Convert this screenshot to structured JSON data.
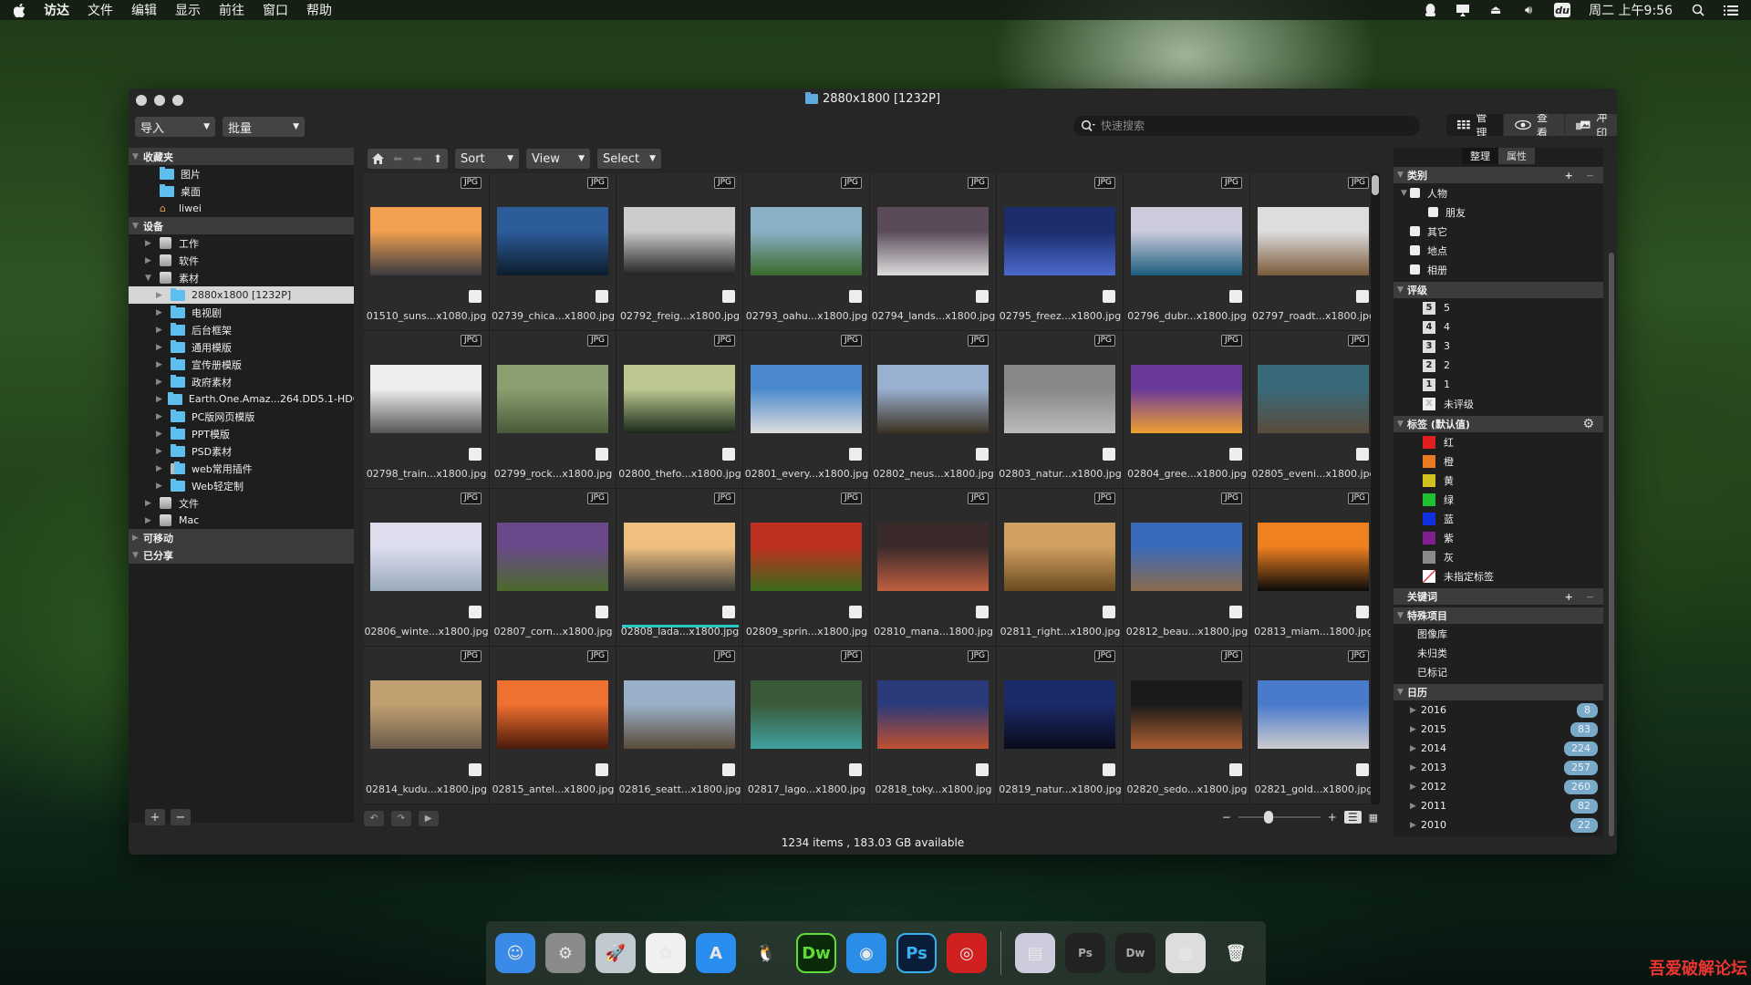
{
  "menubar": {
    "items": [
      "访达",
      "文件",
      "编辑",
      "显示",
      "前往",
      "窗口",
      "帮助"
    ],
    "clock": "周二 上午9:56",
    "icons": [
      "qq-icon",
      "airplay-icon",
      "eject-icon",
      "volume-icon",
      "du-icon",
      "search-icon",
      "list-icon"
    ]
  },
  "window": {
    "title": "2880x1800 [1232P]",
    "import_label": "导入",
    "batch_label": "批量",
    "search_placeholder": "快速搜索",
    "modes": [
      {
        "label": "管理",
        "icon": "grid-icon",
        "active": true
      },
      {
        "label": "查看",
        "icon": "eye-icon",
        "active": false
      },
      {
        "label": "冲印",
        "icon": "print-icon",
        "active": false
      }
    ],
    "extra_icons": [
      "365-icon",
      "sync-icon"
    ]
  },
  "sidebar": {
    "sections": [
      {
        "title": "收藏夹",
        "open": true,
        "items": [
          {
            "label": "图片",
            "icon": "folder",
            "level": 1
          },
          {
            "label": "桌面",
            "icon": "folder",
            "level": 1
          },
          {
            "label": "liwei",
            "icon": "home",
            "level": 1
          }
        ]
      },
      {
        "title": "设备",
        "open": true,
        "items": [
          {
            "label": "工作",
            "icon": "drive",
            "level": 1,
            "tri": "▶"
          },
          {
            "label": "软件",
            "icon": "drive",
            "level": 1,
            "tri": "▶"
          },
          {
            "label": "素材",
            "icon": "drive",
            "level": 1,
            "tri": "▼"
          },
          {
            "label": "2880x1800 [1232P]",
            "icon": "folder",
            "level": 2,
            "tri": "▶",
            "selected": true
          },
          {
            "label": "电视剧",
            "icon": "folder",
            "level": 2,
            "tri": "▶"
          },
          {
            "label": "后台框架",
            "icon": "folder",
            "level": 2,
            "tri": "▶"
          },
          {
            "label": "通用模版",
            "icon": "folder",
            "level": 2,
            "tri": "▶"
          },
          {
            "label": "宣传册模版",
            "icon": "folder",
            "level": 2,
            "tri": "▶"
          },
          {
            "label": "政府素材",
            "icon": "folder",
            "level": 2,
            "tri": "▶"
          },
          {
            "label": "Earth.One.Amaz...264.DD5.1-HDC",
            "icon": "folder",
            "level": 2,
            "tri": "▶"
          },
          {
            "label": "PC版网页模版",
            "icon": "folder",
            "level": 2,
            "tri": "▶"
          },
          {
            "label": "PPT模版",
            "icon": "folder",
            "level": 2,
            "tri": "▶"
          },
          {
            "label": "PSD素材",
            "icon": "folder",
            "level": 2,
            "tri": "▶"
          },
          {
            "label": "web常用插件",
            "icon": "folder-locked",
            "level": 2,
            "tri": "▶"
          },
          {
            "label": "Web轻定制",
            "icon": "folder",
            "level": 2,
            "tri": "▶"
          },
          {
            "label": "文件",
            "icon": "drive",
            "level": 1,
            "tri": "▶"
          },
          {
            "label": "Mac",
            "icon": "drive",
            "level": 1,
            "tri": "▶"
          }
        ]
      },
      {
        "title": "可移动",
        "open": false,
        "items": []
      },
      {
        "title": "已分享",
        "open": true,
        "items": []
      }
    ],
    "add_label": "+",
    "remove_label": "−"
  },
  "navbar": {
    "sort": "Sort",
    "view": "View",
    "select": "Select"
  },
  "files": [
    {
      "name": "01510_suns...x1080.jpg",
      "type": "JPG",
      "colors": [
        "#f0a050",
        "#3a3a40"
      ]
    },
    {
      "name": "02739_chica...x1800.jpg",
      "type": "JPG",
      "colors": [
        "#2c5c9a",
        "#0c1c2c"
      ]
    },
    {
      "name": "02792_freig...x1800.jpg",
      "type": "JPG",
      "colors": [
        "#ccc",
        "#222"
      ]
    },
    {
      "name": "02793_oahu...x1800.jpg",
      "type": "JPG",
      "colors": [
        "#8ab0c8",
        "#3a6a2a"
      ]
    },
    {
      "name": "02794_lands...x1800.jpg",
      "type": "JPG",
      "colors": [
        "#5a4a5a",
        "#ddd"
      ]
    },
    {
      "name": "02795_freez...x1800.jpg",
      "type": "JPG",
      "colors": [
        "#1c2c6c",
        "#4a6acc"
      ]
    },
    {
      "name": "02796_dubr...x1800.jpg",
      "type": "JPG",
      "colors": [
        "#ccd",
        "#1c5c7c"
      ]
    },
    {
      "name": "02797_roadt...x1800.jpg",
      "type": "JPG",
      "colors": [
        "#ddd",
        "#7a5a3a"
      ]
    },
    {
      "name": "02798_train...x1800.jpg",
      "type": "JPG",
      "colors": [
        "#eee",
        "#555"
      ]
    },
    {
      "name": "02799_rock...x1800.jpg",
      "type": "JPG",
      "colors": [
        "#8aa070",
        "#4a5a3a"
      ]
    },
    {
      "name": "02800_thefo...x1800.jpg",
      "type": "JPG",
      "colors": [
        "#bcc890",
        "#1a2a1a"
      ]
    },
    {
      "name": "02801_every...x1800.jpg",
      "type": "JPG",
      "colors": [
        "#4a8acc",
        "#ddd"
      ]
    },
    {
      "name": "02802_neus...x1800.jpg",
      "type": "JPG",
      "colors": [
        "#9ab0d0",
        "#3a3020"
      ]
    },
    {
      "name": "02803_natur...x1800.jpg",
      "type": "JPG",
      "colors": [
        "#888",
        "#bbb"
      ]
    },
    {
      "name": "02804_gree...x1800.jpg",
      "type": "JPG",
      "colors": [
        "#6a3a9a",
        "#f0a030"
      ]
    },
    {
      "name": "02805_eveni...x1800.jpg",
      "type": "JPG",
      "colors": [
        "#3a6a7a",
        "#5a4a3a"
      ]
    },
    {
      "name": "02806_winte...x1800.jpg",
      "type": "JPG",
      "colors": [
        "#dde",
        "#9ab"
      ]
    },
    {
      "name": "02807_corn...x1800.jpg",
      "type": "JPG",
      "colors": [
        "#6a4a8a",
        "#4a6a2a"
      ]
    },
    {
      "name": "02808_lada...x1800.jpg",
      "type": "JPG",
      "colors": [
        "#f0c080",
        "#3a3a3a"
      ]
    },
    {
      "name": "02809_sprin...x1800.jpg",
      "type": "JPG",
      "colors": [
        "#c03020",
        "#3a6a1a"
      ]
    },
    {
      "name": "02810_mana...1800.jpg",
      "type": "JPG",
      "colors": [
        "#3a2a2a",
        "#c06040"
      ]
    },
    {
      "name": "02811_right...x1800.jpg",
      "type": "JPG",
      "colors": [
        "#d0a060",
        "#6a4a20"
      ]
    },
    {
      "name": "02812_beau...x1800.jpg",
      "type": "JPG",
      "colors": [
        "#3a6aba",
        "#8a6a4a"
      ]
    },
    {
      "name": "02813_miam...1800.jpg",
      "type": "JPG",
      "colors": [
        "#f08020",
        "#0a0a0a"
      ]
    },
    {
      "name": "02814_kudu...x1800.jpg",
      "type": "JPG",
      "colors": [
        "#c0a070",
        "#6a5a4a"
      ]
    },
    {
      "name": "02815_antel...x1800.jpg",
      "type": "JPG",
      "colors": [
        "#f07030",
        "#4a1a0a"
      ]
    },
    {
      "name": "02816_seatt...x1800.jpg",
      "type": "JPG",
      "colors": [
        "#9ab0c8",
        "#5a4a3a"
      ]
    },
    {
      "name": "02817_lago...x1800.jpg",
      "type": "JPG",
      "colors": [
        "#3a5a3a",
        "#40a0a0"
      ]
    },
    {
      "name": "02818_toky...x1800.jpg",
      "type": "JPG",
      "colors": [
        "#2a3a7a",
        "#c05030"
      ]
    },
    {
      "name": "02819_natur...x1800.jpg",
      "type": "JPG",
      "colors": [
        "#1a2a6a",
        "#0a0a1a"
      ]
    },
    {
      "name": "02820_sedo...x1800.jpg",
      "type": "JPG",
      "colors": [
        "#1a1a1a",
        "#b06030"
      ]
    },
    {
      "name": "02821_gold...x1800.jpg",
      "type": "JPG",
      "colors": [
        "#4a7acc",
        "#ccc"
      ]
    }
  ],
  "selected_file_index": 18,
  "status": "1234 items , 183.03 GB available",
  "thumbnail_zoom": 0.35,
  "right_panel": {
    "tabs": [
      {
        "label": "整理",
        "active": true
      },
      {
        "label": "属性",
        "active": false
      }
    ],
    "categories": {
      "title": "类别",
      "items": [
        {
          "label": "人物",
          "level": 0,
          "tri": "▼"
        },
        {
          "label": "朋友",
          "level": 1
        },
        {
          "label": "其它",
          "level": 0
        },
        {
          "label": "地点",
          "level": 0
        },
        {
          "label": "相册",
          "level": 0
        }
      ]
    },
    "ratings": {
      "title": "评级",
      "items": [
        {
          "badge": "5",
          "label": "5"
        },
        {
          "badge": "4",
          "label": "4"
        },
        {
          "badge": "3",
          "label": "3"
        },
        {
          "badge": "2",
          "label": "2"
        },
        {
          "badge": "1",
          "label": "1"
        },
        {
          "badge": "X",
          "label": "未评级"
        }
      ]
    },
    "labels": {
      "title": "标签 (默认值)",
      "items": [
        {
          "label": "红",
          "color": "#e02020"
        },
        {
          "label": "橙",
          "color": "#e87a20"
        },
        {
          "label": "黄",
          "color": "#d0c020"
        },
        {
          "label": "绿",
          "color": "#20c030"
        },
        {
          "label": "蓝",
          "color": "#1030e0"
        },
        {
          "label": "紫",
          "color": "#802090"
        },
        {
          "label": "灰",
          "color": "#8a8a8a"
        },
        {
          "label": "未指定标签",
          "color": "none"
        }
      ]
    },
    "keywords": {
      "title": "关键词"
    },
    "special": {
      "title": "特殊项目",
      "items": [
        "图像库",
        "未归类",
        "已标记"
      ]
    },
    "calendar": {
      "title": "日历",
      "items": [
        {
          "year": "2016",
          "count": "8"
        },
        {
          "year": "2015",
          "count": "83"
        },
        {
          "year": "2014",
          "count": "224"
        },
        {
          "year": "2013",
          "count": "257"
        },
        {
          "year": "2012",
          "count": "260"
        },
        {
          "year": "2011",
          "count": "82"
        },
        {
          "year": "2010",
          "count": "22"
        }
      ]
    }
  },
  "dock": {
    "apps": [
      {
        "name": "finder",
        "label": "☺",
        "bg": "#3a8ae8"
      },
      {
        "name": "system-preferences",
        "label": "⚙",
        "bg": "#8a8a8a"
      },
      {
        "name": "launchpad",
        "label": "🚀",
        "bg": "#c0c8d0"
      },
      {
        "name": "photos",
        "label": "✿",
        "bg": "#f0f0f0"
      },
      {
        "name": "app-store",
        "label": "A",
        "bg": "#2a8ef0"
      },
      {
        "name": "qq",
        "label": "🐧",
        "bg": "transparent"
      },
      {
        "name": "dreamweaver",
        "label": "Dw",
        "bg": "#0a2a0a"
      },
      {
        "name": "browser",
        "label": "◉",
        "bg": "#2a8ee8"
      },
      {
        "name": "photoshop",
        "label": "Ps",
        "bg": "#0a1e3a"
      },
      {
        "name": "photo-app",
        "label": "◎",
        "bg": "#d02020"
      }
    ],
    "others": [
      {
        "name": "document",
        "label": "▤",
        "bg": "#ccd"
      },
      {
        "name": "ps-window",
        "label": "Ps",
        "bg": "#222"
      },
      {
        "name": "dw-window",
        "label": "Dw",
        "bg": "#222"
      },
      {
        "name": "preview",
        "label": "▦",
        "bg": "#ddd"
      },
      {
        "name": "trash",
        "label": "🗑",
        "bg": "transparent"
      }
    ]
  },
  "watermark": "吾爱破解论坛"
}
